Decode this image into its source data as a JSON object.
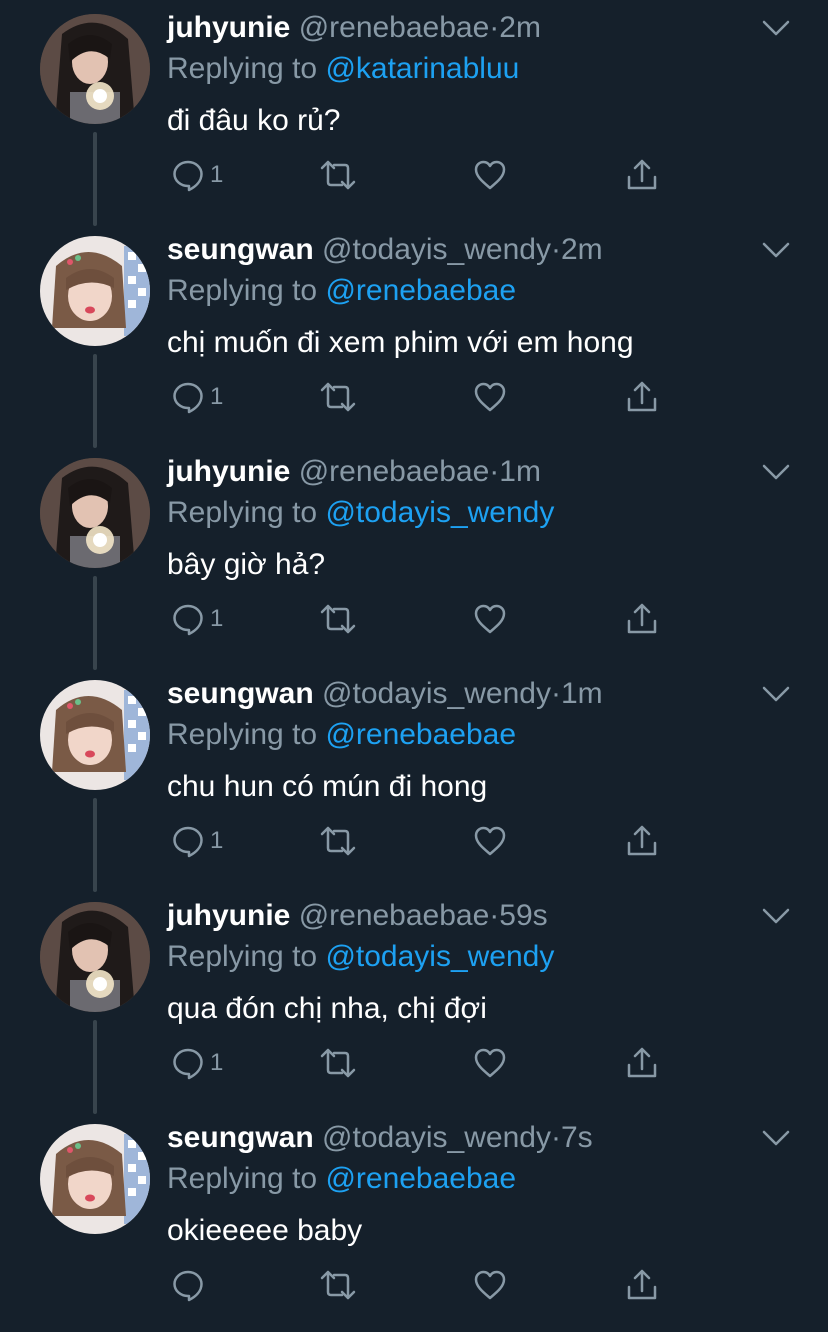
{
  "thread": {
    "tweets": [
      {
        "name": "juhyunie",
        "handle": "@renebaebae",
        "separator": "·",
        "time": "2m",
        "replying_prefix": "Replying to",
        "replying_to": "@katarinabluu",
        "text": "đi đâu ko rủ?",
        "reply_count": "1",
        "avatar_icon": "juhyunie-avatar",
        "has_thread_line": true
      },
      {
        "name": "seungwan",
        "handle": "@todayis_wendy",
        "separator": "·",
        "time": "2m",
        "replying_prefix": "Replying to",
        "replying_to": "@renebaebae",
        "text": "chị muốn đi xem phim với em hong",
        "reply_count": "1",
        "avatar_icon": "seungwan-avatar",
        "has_thread_line": true
      },
      {
        "name": "juhyunie",
        "handle": "@renebaebae",
        "separator": "·",
        "time": "1m",
        "replying_prefix": "Replying to",
        "replying_to": "@todayis_wendy",
        "text": "bây giờ hả?",
        "reply_count": "1",
        "avatar_icon": "juhyunie-avatar",
        "has_thread_line": true
      },
      {
        "name": "seungwan",
        "handle": "@todayis_wendy",
        "separator": "·",
        "time": "1m",
        "replying_prefix": "Replying to",
        "replying_to": "@renebaebae",
        "text": "chu hun có mún đi hong",
        "reply_count": "1",
        "avatar_icon": "seungwan-avatar",
        "has_thread_line": true
      },
      {
        "name": "juhyunie",
        "handle": "@renebaebae",
        "separator": "·",
        "time": "59s",
        "replying_prefix": "Replying to",
        "replying_to": "@todayis_wendy",
        "text": "qua đón chị nha, chị đợi",
        "reply_count": "1",
        "avatar_icon": "juhyunie-avatar",
        "has_thread_line": true
      },
      {
        "name": "seungwan",
        "handle": "@todayis_wendy",
        "separator": "·",
        "time": "7s",
        "replying_prefix": "Replying to",
        "replying_to": "@renebaebae",
        "text": "okieeeee baby",
        "reply_count": "",
        "avatar_icon": "seungwan-avatar",
        "has_thread_line": false
      }
    ]
  },
  "icons": {
    "reply": "reply-icon",
    "retweet": "retweet-icon",
    "like": "heart-icon",
    "share": "share-icon",
    "caret": "chevron-down-icon"
  },
  "colors": {
    "background": "#15202b",
    "text_primary": "#ffffff",
    "text_secondary": "#8899a6",
    "accent": "#1da1f2",
    "thread_line": "#38444d"
  }
}
